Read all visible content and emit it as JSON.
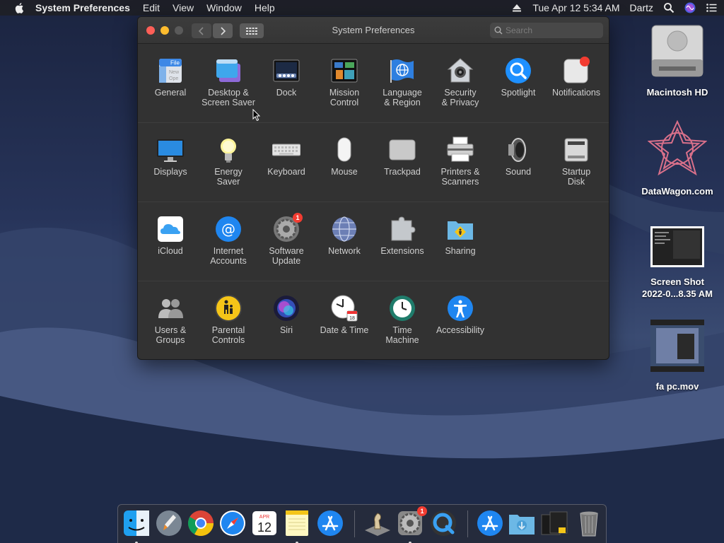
{
  "menubar": {
    "app_name": "System Preferences",
    "menus": [
      "Edit",
      "View",
      "Window",
      "Help"
    ],
    "datetime": "Tue Apr 12  5:34 AM",
    "user": "Dartz"
  },
  "window": {
    "title": "System Preferences",
    "search_placeholder": "Search"
  },
  "rows": [
    [
      {
        "label": "General",
        "icon": "general-icon"
      },
      {
        "label": "Desktop &\nScreen Saver",
        "icon": "desktop-screensaver-icon"
      },
      {
        "label": "Dock",
        "icon": "dock-icon"
      },
      {
        "label": "Mission\nControl",
        "icon": "mission-control-icon"
      },
      {
        "label": "Language\n& Region",
        "icon": "language-region-icon"
      },
      {
        "label": "Security\n& Privacy",
        "icon": "security-privacy-icon"
      },
      {
        "label": "Spotlight",
        "icon": "spotlight-icon"
      },
      {
        "label": "Notifications",
        "icon": "notifications-icon"
      }
    ],
    [
      {
        "label": "Displays",
        "icon": "displays-icon"
      },
      {
        "label": "Energy\nSaver",
        "icon": "energy-saver-icon"
      },
      {
        "label": "Keyboard",
        "icon": "keyboard-icon"
      },
      {
        "label": "Mouse",
        "icon": "mouse-icon"
      },
      {
        "label": "Trackpad",
        "icon": "trackpad-icon"
      },
      {
        "label": "Printers &\nScanners",
        "icon": "printers-scanners-icon"
      },
      {
        "label": "Sound",
        "icon": "sound-icon"
      },
      {
        "label": "Startup\nDisk",
        "icon": "startup-disk-icon"
      }
    ],
    [
      {
        "label": "iCloud",
        "icon": "icloud-icon"
      },
      {
        "label": "Internet\nAccounts",
        "icon": "internet-accounts-icon"
      },
      {
        "label": "Software\nUpdate",
        "icon": "software-update-icon",
        "badge": "1"
      },
      {
        "label": "Network",
        "icon": "network-icon"
      },
      {
        "label": "Extensions",
        "icon": "extensions-icon"
      },
      {
        "label": "Sharing",
        "icon": "sharing-icon"
      }
    ],
    [
      {
        "label": "Users &\nGroups",
        "icon": "users-groups-icon"
      },
      {
        "label": "Parental\nControls",
        "icon": "parental-controls-icon"
      },
      {
        "label": "Siri",
        "icon": "siri-icon"
      },
      {
        "label": "Date & Time",
        "icon": "date-time-icon"
      },
      {
        "label": "Time\nMachine",
        "icon": "time-machine-icon"
      },
      {
        "label": "Accessibility",
        "icon": "accessibility-icon"
      }
    ]
  ],
  "desktop": [
    {
      "label": "Macintosh HD",
      "icon": "hard-drive-icon"
    },
    {
      "label": "DataWagon.com",
      "icon": "datawagon-icon"
    },
    {
      "label": "Screen Shot\n2022-0...8.35 AM",
      "icon": "screenshot-file-icon"
    },
    {
      "label": "fa pc.mov",
      "icon": "movie-file-icon"
    }
  ],
  "dock": {
    "calendar_month": "APR",
    "calendar_day": "12",
    "sysprefs_badge": "1",
    "items": [
      "finder-icon",
      "launchpad-icon",
      "chrome-icon",
      "safari-icon",
      "calendar-icon",
      "notes-icon",
      "app-store-icon",
      "chess-icon",
      "system-preferences-icon",
      "quicktime-icon",
      "applications-folder-icon",
      "downloads-folder-icon",
      "documents-stack-icon",
      "trash-icon"
    ]
  },
  "colors": {
    "window_bg": "#323232",
    "close": "#fe5f57",
    "minimize": "#febc2e",
    "badge": "#f23c31",
    "accent_blue": "#1e90ff"
  }
}
